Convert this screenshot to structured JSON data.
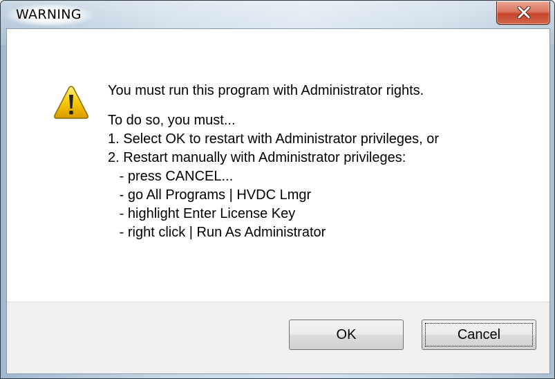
{
  "window": {
    "title": "WARNING",
    "close_icon": "close-x-icon"
  },
  "dialog": {
    "icon": "warning-triangle-icon",
    "headline": "You must run this program with Administrator rights.",
    "lines": [
      "To do so, you must...",
      "1. Select OK to restart with Administrator privileges, or",
      "2. Restart manually with Administrator privileges:",
      "   - press CANCEL...",
      "   - go All Programs | HVDC Lmgr",
      "   - highlight Enter License Key",
      "   - right click | Run As Administrator"
    ]
  },
  "buttons": {
    "ok_label": "OK",
    "cancel_label": "Cancel"
  },
  "colors": {
    "close_button": "#c4452b",
    "warning_yellow": "#f5c400"
  }
}
